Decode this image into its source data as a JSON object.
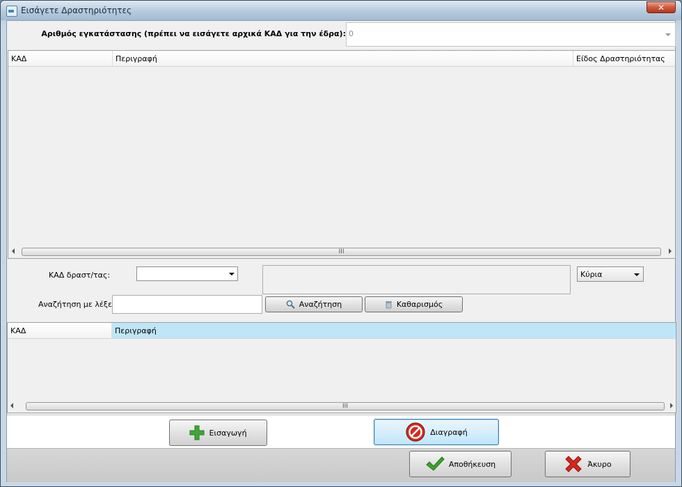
{
  "window": {
    "title": "Εισάγετε Δραστηριότητες",
    "close_glyph": "✕"
  },
  "installation": {
    "label": "Αριθμός εγκατάστασης (πρέπει να εισάγετε αρχικά ΚΑΔ για την έδρα):",
    "value": "0"
  },
  "top_grid": {
    "columns": [
      "ΚΑΔ",
      "Περιγραφή",
      "Είδος Δραστηριότητας"
    ],
    "thumb_glyph": "III"
  },
  "search": {
    "kad_label": "ΚΑΔ δραστ/τας:",
    "kad_value": "",
    "type_value": "Κύρια",
    "keywords_label": "Αναζήτηση με λέξεις:",
    "keywords_value": "",
    "search_button": "Αναζήτηση",
    "clear_button": "Καθαρισμός"
  },
  "bottom_grid": {
    "columns": [
      "ΚΑΔ",
      "Περιγραφή"
    ],
    "thumb_glyph": "III"
  },
  "actions": {
    "insert_button": "Εισαγωγή",
    "delete_button": "Διαγραφή",
    "save_button": "Αποθήκευση",
    "cancel_button": "Άκυρο"
  },
  "colors": {
    "selected_header": "#bfe6f7",
    "insert_icon": "#3fa836",
    "delete_icon": "#d42a1f",
    "save_icon": "#3aa528",
    "cancel_icon": "#d7261c"
  },
  "icons": {
    "search": "magnifier-icon",
    "clear": "trash-can-icon",
    "insert": "plus-icon",
    "delete": "no-entry-icon",
    "save": "checkmark-icon",
    "cancel": "x-icon"
  }
}
